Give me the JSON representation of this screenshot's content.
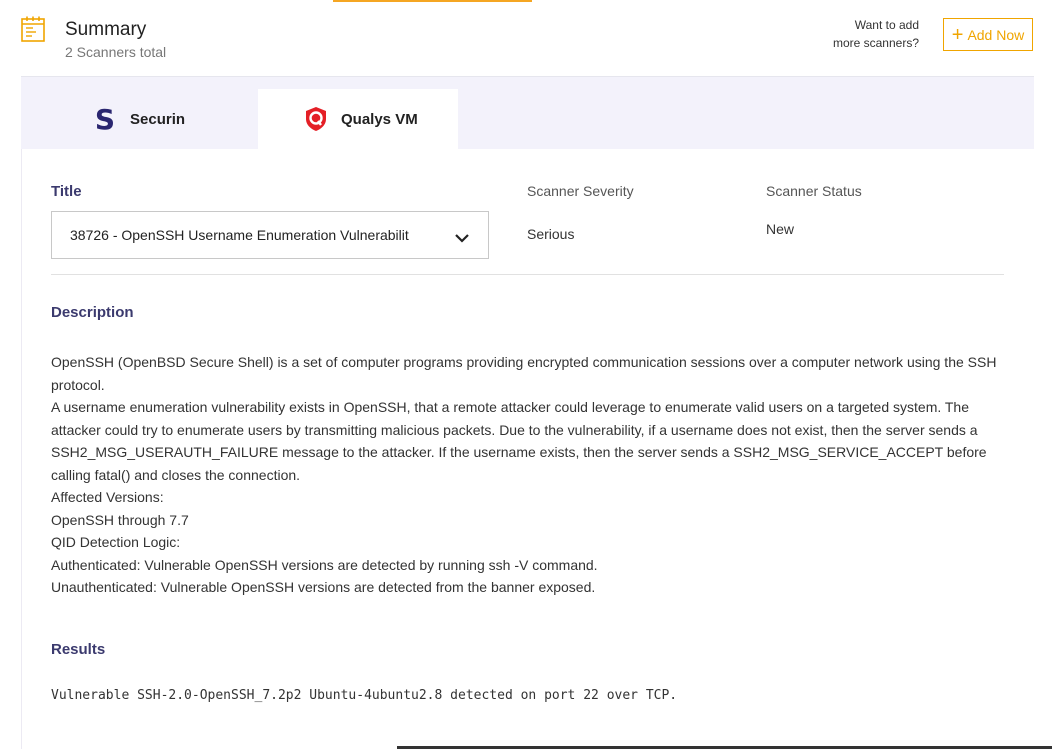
{
  "header": {
    "title": "Summary",
    "subtitle": "2 Scanners total",
    "add_prompt_line1": "Want to add",
    "add_prompt_line2": "more scanners?",
    "add_button_label": "Add Now",
    "accent_color": "#f0a500"
  },
  "tabs": [
    {
      "label": "Securin",
      "icon": "securin-logo-icon",
      "active": false
    },
    {
      "label": "Qualys VM",
      "icon": "qualys-logo-icon",
      "active": true
    }
  ],
  "details": {
    "title_label": "Title",
    "title_value": "38726 - OpenSSH Username Enumeration Vulnerabilit",
    "severity_label": "Scanner Severity",
    "severity_value": "Serious",
    "status_label": "Scanner Status",
    "status_value": "New"
  },
  "description": {
    "heading": "Description",
    "lines": [
      "OpenSSH (OpenBSD Secure Shell) is a set of computer programs providing encrypted communication sessions over a computer network using the SSH protocol.",
      "A username enumeration vulnerability exists in OpenSSH, that a remote attacker could leverage to enumerate valid users on a targeted system. The attacker could try to enumerate users by transmitting malicious packets. Due to the vulnerability, if a username does not exist, then the server sends a SSH2_MSG_USERAUTH_FAILURE message to the attacker. If the username exists, then the server sends a SSH2_MSG_SERVICE_ACCEPT before calling fatal() and closes the connection.",
      "Affected Versions:",
      "OpenSSH through 7.7",
      "QID Detection Logic:",
      "Authenticated: Vulnerable OpenSSH versions are detected by running ssh -V command.",
      "Unauthenticated: Vulnerable OpenSSH versions are detected from the banner exposed."
    ]
  },
  "results": {
    "heading": "Results",
    "text": "Vulnerable SSH-2.0-OpenSSH_7.2p2 Ubuntu-4ubuntu2.8 detected on port 22 over TCP."
  }
}
